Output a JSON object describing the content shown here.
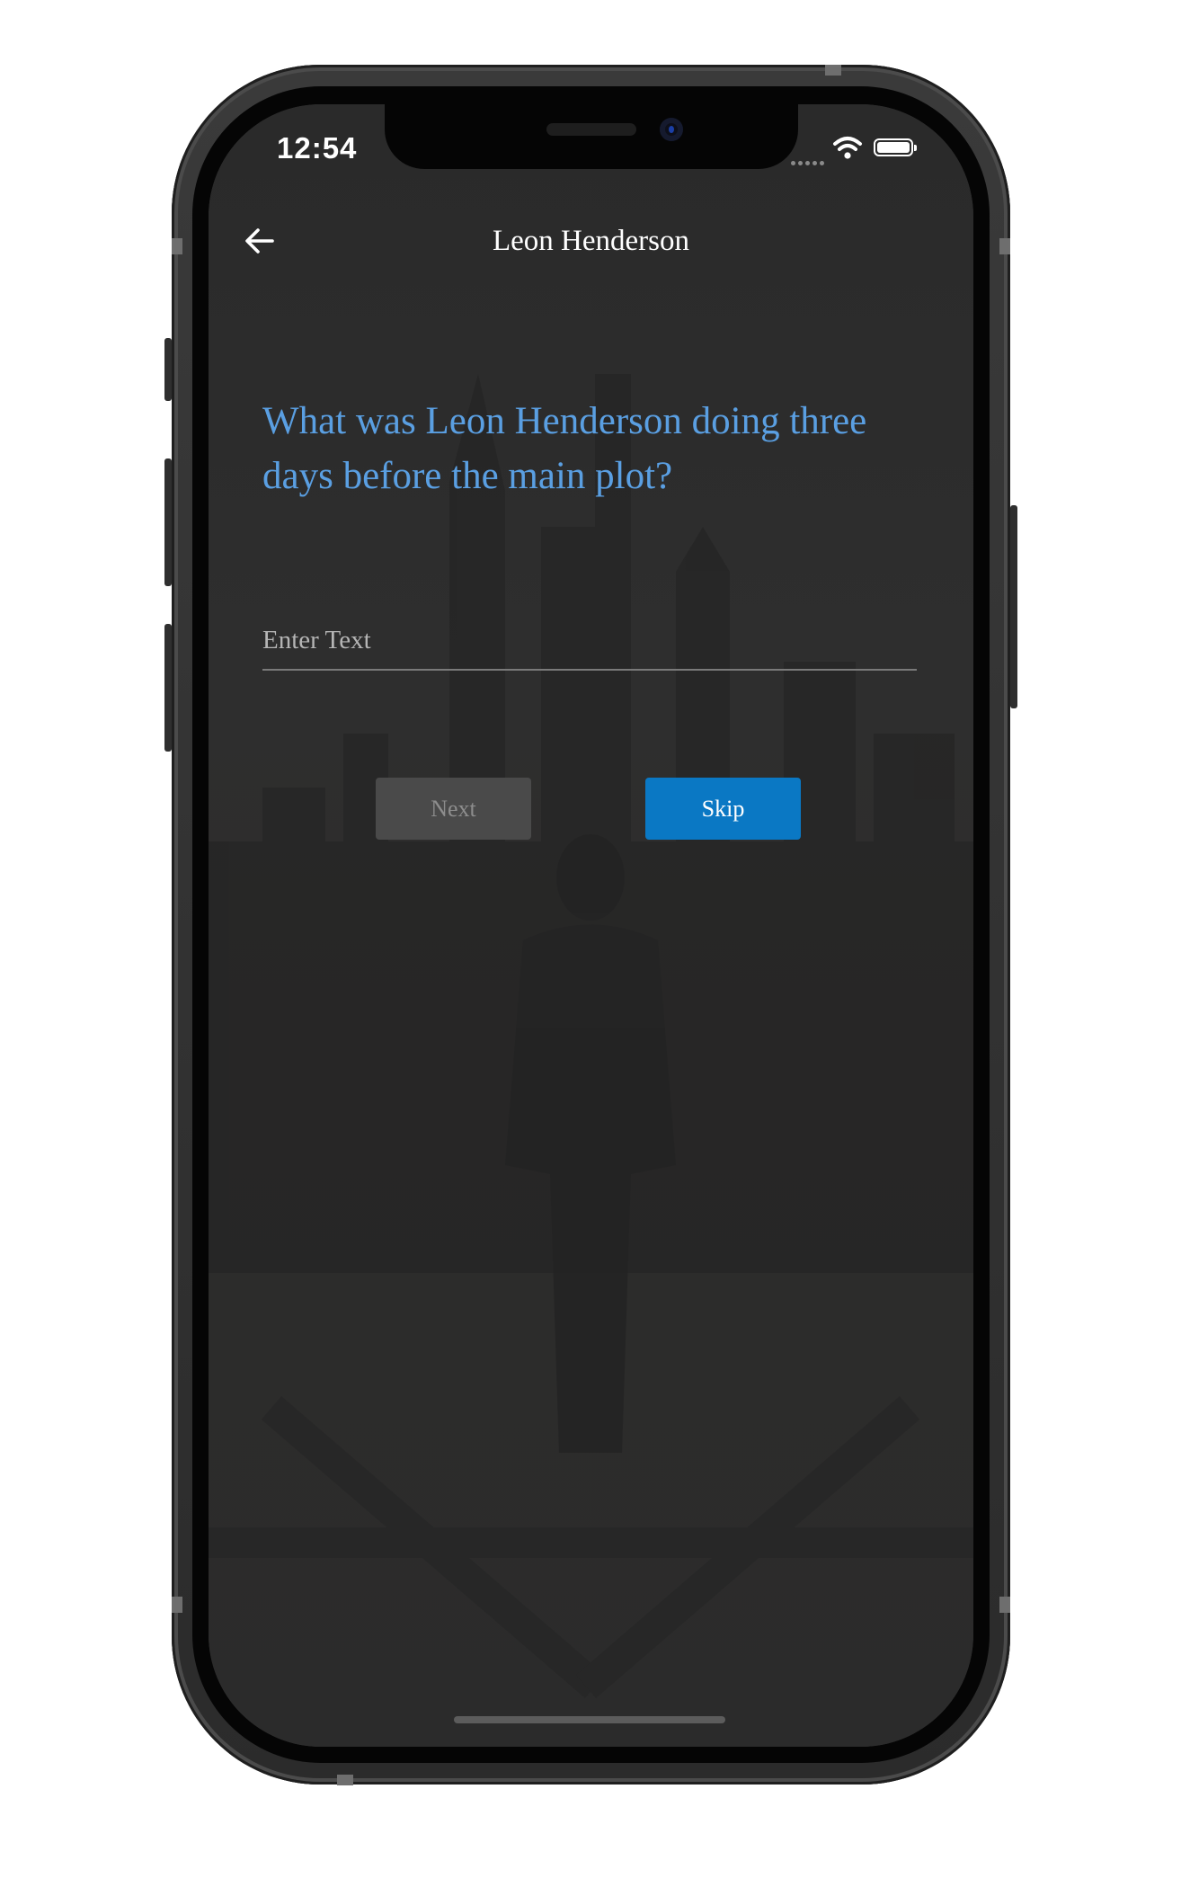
{
  "status_bar": {
    "time": "12:54"
  },
  "header": {
    "title": "Leon Henderson"
  },
  "question": {
    "text": "What was Leon Henderson doing three days before the main plot?"
  },
  "answer_input": {
    "value": "",
    "placeholder": "Enter Text"
  },
  "buttons": {
    "next_label": "Next",
    "skip_label": "Skip"
  },
  "colors": {
    "question_text": "#5a9fe2",
    "skip_button": "#0a78c4",
    "next_button_disabled": "#4a4a4a",
    "screen_background": "#2c2c2c"
  },
  "icons": {
    "back": "arrow-left",
    "wifi": "wifi",
    "battery": "battery-full"
  }
}
